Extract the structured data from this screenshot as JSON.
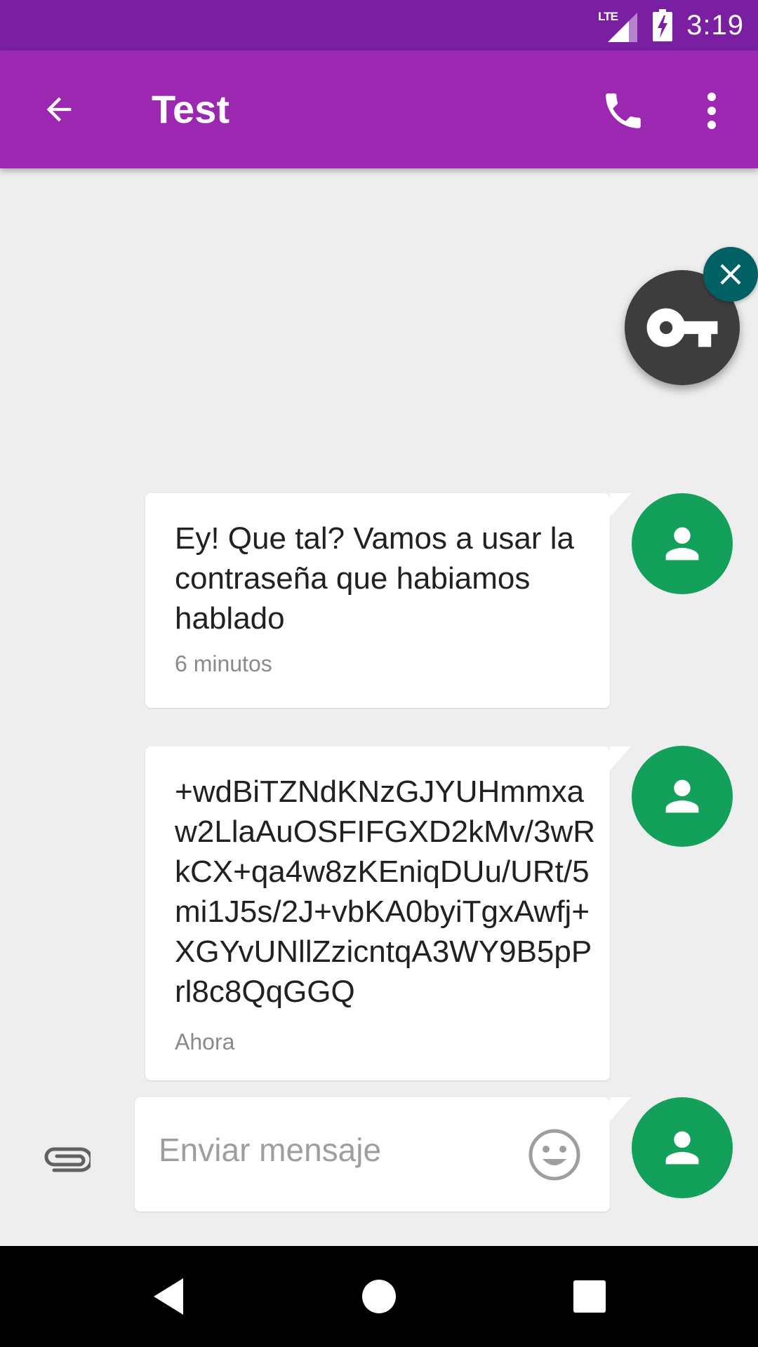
{
  "status_bar": {
    "network_label": "LTE",
    "time": "3:19",
    "icons": [
      "signal-icon",
      "battery-charging-icon"
    ]
  },
  "app_bar": {
    "title": "Test",
    "icons": [
      "back-arrow-icon",
      "phone-icon",
      "overflow-menu-icon"
    ],
    "background_color": "#9c27b0",
    "status_bar_color": "#7b1fa2"
  },
  "overlay": {
    "icons": [
      "key-icon",
      "close-icon"
    ]
  },
  "messages": [
    {
      "text": "Ey! Que tal? Vamos a usar la contraseña que habiamos hablado",
      "time": "6 minutos"
    },
    {
      "text": "+wdBiTZNdKNzGJYUHmmxaw2LlaAuOSFIFGXD2kMv/3wRkCX+qa4w8zKEniqDUu/URt/5mi1J5s/2J+vbKA0byiTgxAwfj+XGYvUNllZzicntqA3WY9B5pPrl8c8QqGGQ",
      "time": "Ahora"
    }
  ],
  "avatar_color": "#12a05b",
  "compose": {
    "placeholder": "Enviar mensaje",
    "icons": [
      "paperclip-icon",
      "emoji-icon"
    ]
  },
  "nav_bar": {
    "icons": [
      "nav-back-icon",
      "nav-home-icon",
      "nav-recents-icon"
    ]
  }
}
